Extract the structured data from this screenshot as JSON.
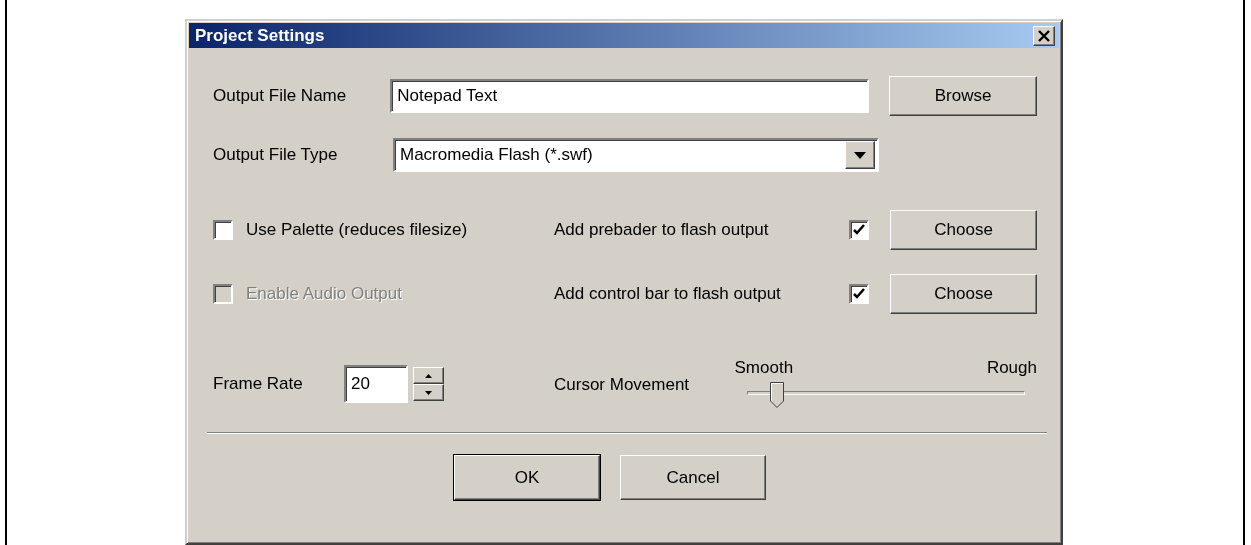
{
  "window": {
    "title": "Project Settings"
  },
  "output_file_name": {
    "label": "Output File Name",
    "value": "Notepad Text",
    "button": "Browse"
  },
  "output_file_type": {
    "label": "Output File Type",
    "value": "Macromedia Flash (*.swf)"
  },
  "options": [
    {
      "label": "Use Palette (reduces filesize)",
      "checked": false,
      "disabled": false
    },
    {
      "label": "Enable Audio Output",
      "checked": false,
      "disabled": true
    }
  ],
  "flash_options": [
    {
      "label": "Add prebader to flash output",
      "checked": true,
      "button": "Choose"
    },
    {
      "label": "Add control bar to flash output",
      "checked": true,
      "button": "Choose"
    }
  ],
  "frame_rate": {
    "label": "Frame Rate",
    "value": "20"
  },
  "cursor_movement": {
    "label": "Cursor Movement",
    "min_label": "Smooth",
    "max_label": "Rough",
    "level": 0.11
  },
  "buttons": [
    {
      "label": "OK",
      "default": true
    },
    {
      "label": "Cancel",
      "default": false
    }
  ]
}
